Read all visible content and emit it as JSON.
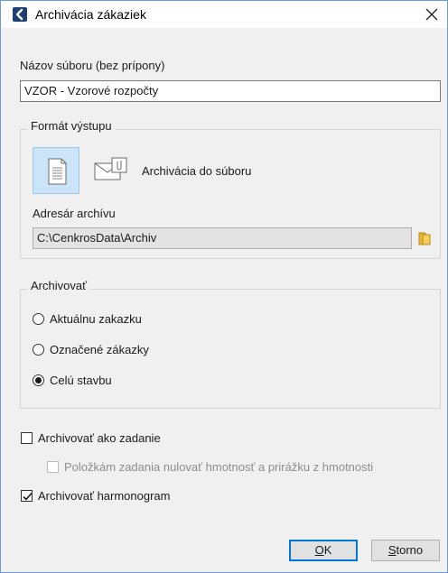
{
  "window": {
    "title": "Archivácia zákaziek"
  },
  "filename": {
    "label": "Názov súboru  (bez prípony)",
    "value": "VZOR - Vzorové rozpočty"
  },
  "output_format": {
    "group_title": "Formát výstupu",
    "archive_to_file_label": "Archivácia do súboru",
    "directory_label": "Adresár archívu",
    "directory_value": "C:\\CenkrosData\\Archiv"
  },
  "archive": {
    "group_title": "Archivovať",
    "options": [
      {
        "label": "Aktuálnu zakazku",
        "checked": false
      },
      {
        "label": "Označené zákazky",
        "checked": false
      },
      {
        "label": "Celú stavbu",
        "checked": true
      }
    ]
  },
  "checks": {
    "as_assignment": {
      "label": "Archivovať ako zadanie",
      "checked": false
    },
    "zero_mass": {
      "label": "Položkám zadania nulovať hmotnosť a prirážku z hmotnosti",
      "checked": false,
      "enabled": false
    },
    "harmonogram": {
      "label": "Archivovať harmonogram",
      "checked": true
    }
  },
  "buttons": {
    "ok_prefix": "O",
    "ok_rest": "K",
    "cancel_prefix": "S",
    "cancel_rest": "torno"
  }
}
